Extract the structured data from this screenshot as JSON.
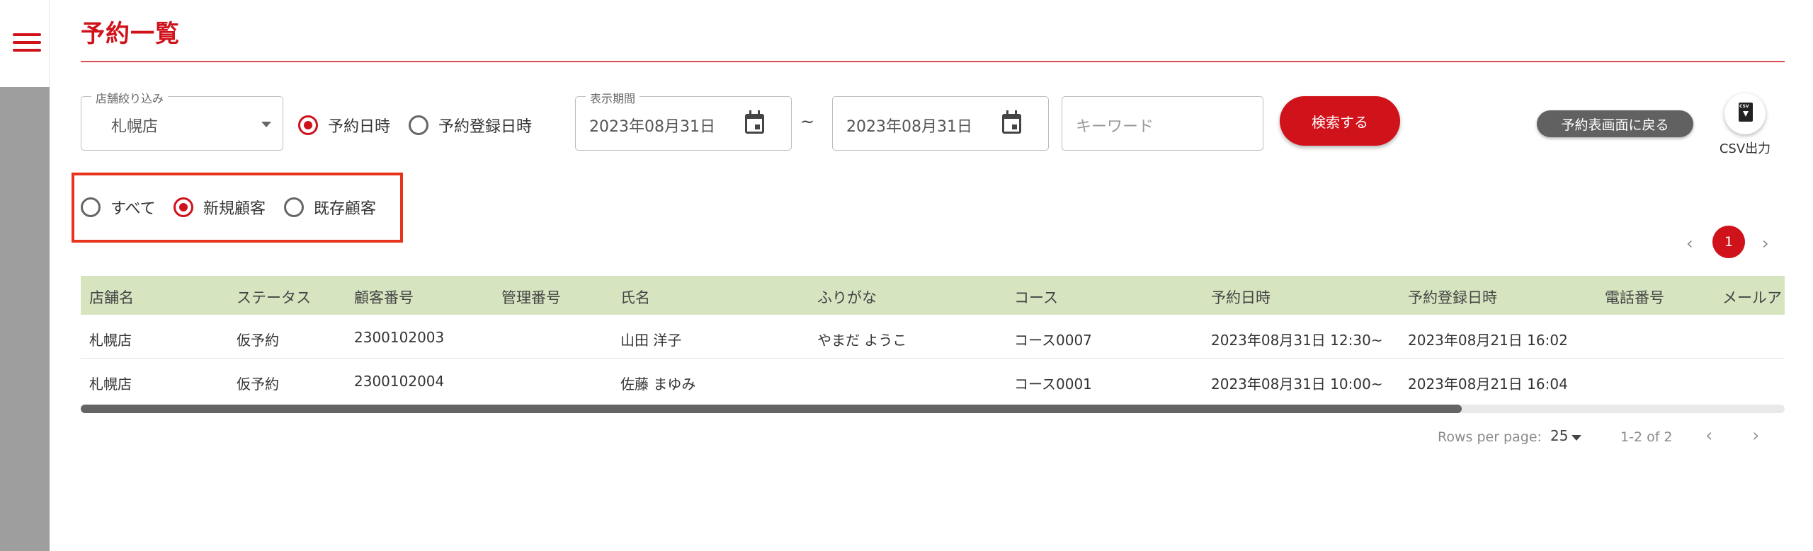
{
  "page": {
    "title": "予約一覧"
  },
  "filters": {
    "store": {
      "legend": "店舗絞り込み",
      "value": "札幌店"
    },
    "date_type": {
      "options": [
        "予約日時",
        "予約登録日時"
      ],
      "selected": "予約日時"
    },
    "period": {
      "legend": "表示期間",
      "from": "2023年08月31日",
      "to": "2023年08月31日",
      "separator": "~"
    },
    "keyword": {
      "placeholder": "キーワード"
    },
    "customer_type": {
      "options": [
        "すべて",
        "新規顧客",
        "既存顧客"
      ],
      "selected": "新規顧客"
    }
  },
  "actions": {
    "search_label": "検索する",
    "back_label": "予約表画面に戻る",
    "csv_label": "CSV出力",
    "csv_icon_text": "CSV"
  },
  "pagination_top": {
    "prev": "‹",
    "current_page": "1",
    "next": "›"
  },
  "table": {
    "columns": [
      "店舗名",
      "ステータス",
      "顧客番号",
      "管理番号",
      "氏名",
      "ふりがな",
      "コース",
      "予約日時",
      "予約登録日時",
      "電話番号",
      "メールアドレス"
    ],
    "rows": [
      [
        "札幌店",
        "仮予約",
        "2300102003",
        "",
        "山田 洋子",
        "やまだ ようこ",
        "コース0007",
        "2023年08月31日 12:30~",
        "2023年08月21日 16:02",
        "",
        ""
      ],
      [
        "札幌店",
        "仮予約",
        "2300102004",
        "",
        "佐藤 まゆみ",
        "",
        "コース0001",
        "2023年08月31日 10:00~",
        "2023年08月21日 16:04",
        "",
        ""
      ]
    ]
  },
  "footer": {
    "rows_per_page_label": "Rows per page:",
    "rows_per_page_value": "25",
    "range": "1-2 of 2",
    "prev": "‹",
    "next": "›"
  },
  "colors": {
    "accent": "#d0121b",
    "header_row": "#d6e4c0",
    "highlight": "#e8341c",
    "rail": "#9e9e9e"
  }
}
